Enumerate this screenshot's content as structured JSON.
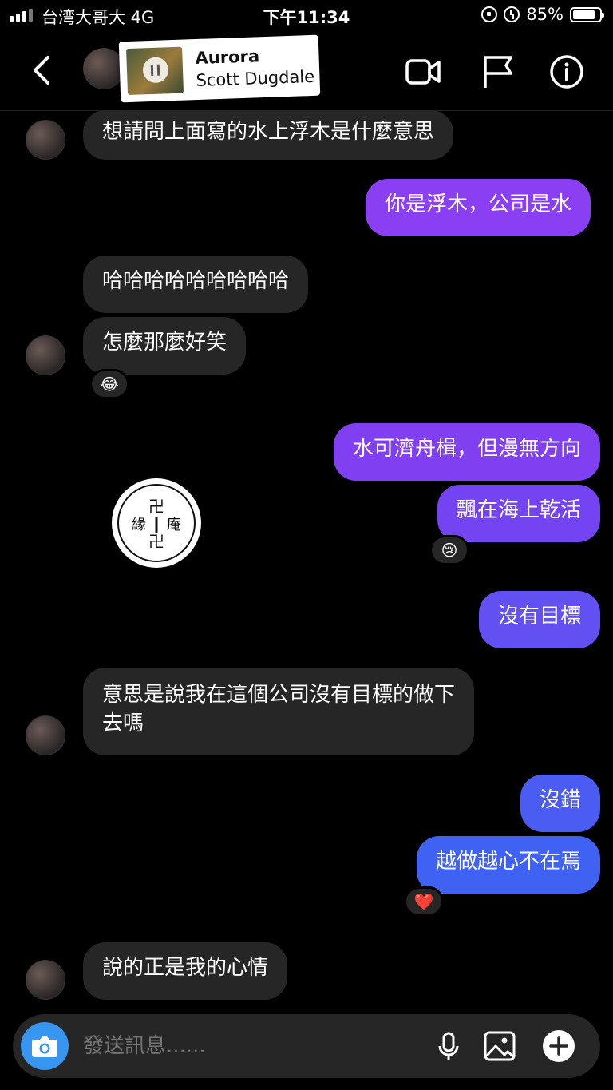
{
  "status_bar": {
    "carrier": "台湾大哥大  4G",
    "time": "下午11:34",
    "battery": "85%"
  },
  "header": {
    "music": {
      "title": "Aurora",
      "artist": "Scott Dugdale"
    }
  },
  "messages": [
    {
      "side": "in",
      "text": "想請問上面寫的水上浮木是什麼意思"
    },
    {
      "side": "out",
      "text": "你是浮木，公司是水"
    },
    {
      "side": "in",
      "text": "哈哈哈哈哈哈哈哈哈"
    },
    {
      "side": "in",
      "text": "怎麼那麼好笑",
      "reaction": "😂"
    },
    {
      "side": "out",
      "text": "水可濟舟楫，但漫無方向"
    },
    {
      "side": "out",
      "text": "飄在海上乾活",
      "reaction": "😢"
    },
    {
      "side": "out",
      "text": "沒有目標"
    },
    {
      "side": "in",
      "text": "意思是說我在這個公司沒有目標的做下",
      "text2": "去嗎"
    },
    {
      "side": "out",
      "text": "沒錯"
    },
    {
      "side": "out",
      "text": "越做越心不在焉",
      "reaction": "❤️"
    },
    {
      "side": "in",
      "text": "說的正是我的心情"
    }
  ],
  "seal": {
    "chars": [
      "卍",
      "緣",
      "庵",
      "卍"
    ]
  },
  "composer": {
    "placeholder": "發送訊息......"
  },
  "colors": {
    "incoming": "#262626",
    "outgoing_top": "#8a3ff2",
    "outgoing_bottom": "#3e63f2",
    "camera": "#3797f0"
  }
}
